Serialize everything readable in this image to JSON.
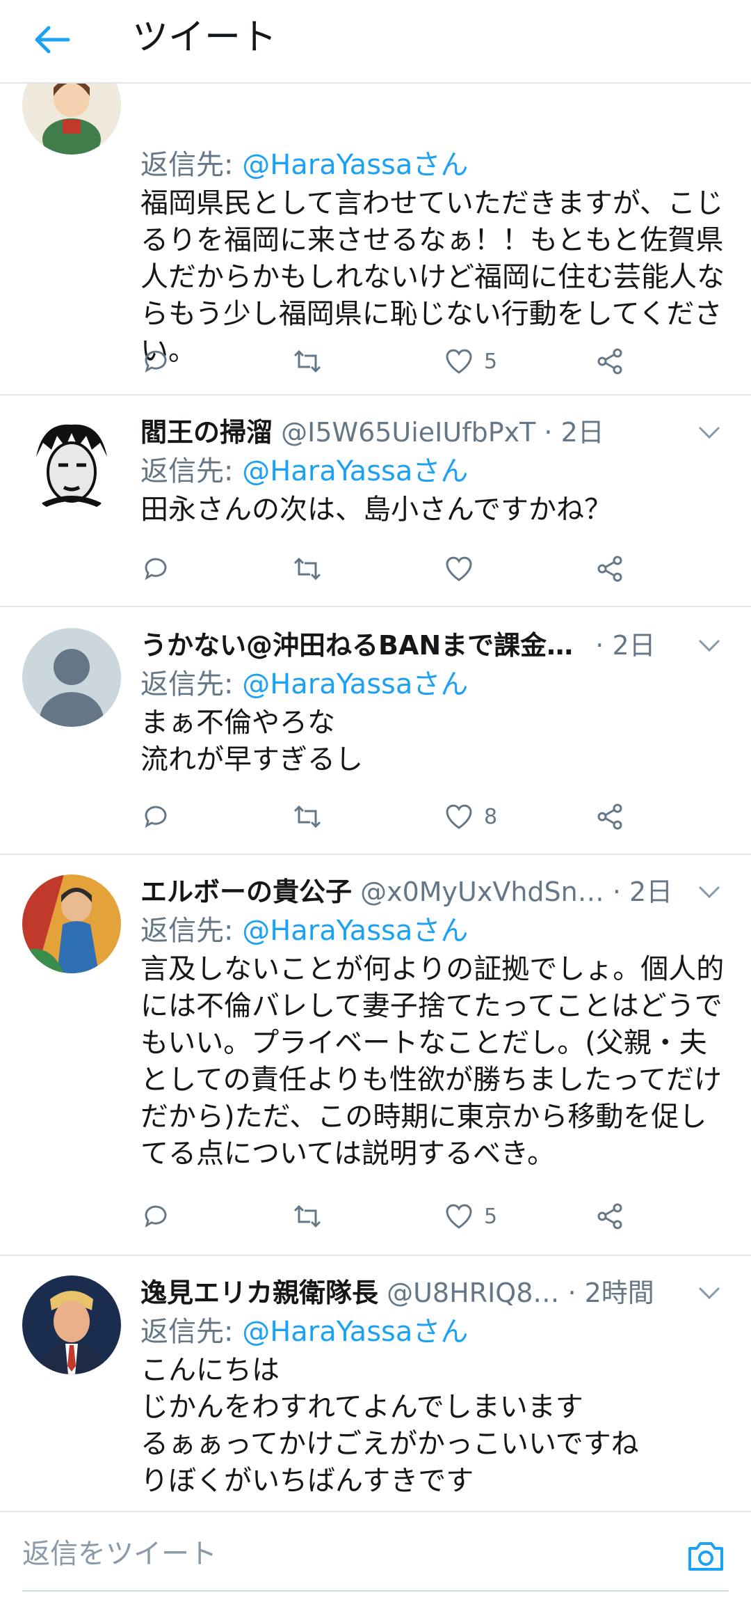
{
  "header": {
    "title": "ツイート"
  },
  "reply_prefix": "返信先: ",
  "tweets": [
    {
      "reply_to": "@HaraYassaさん",
      "body": "福岡県民として言わせていただきますが、こじるりを福岡に来させるなぁ！！もともと佐賀県人だからかもしれないけど福岡に住む芸能人ならもう少し福岡県に恥じない行動をしてください。",
      "likes": "5"
    },
    {
      "name": "閻王の掃溜",
      "handle": "@I5W65UieIUfbPxT",
      "time": "· 2日",
      "reply_to": "@HaraYassaさん",
      "body": "田永さんの次は、島小さんですかね？",
      "likes": ""
    },
    {
      "name": "うかない@沖田ねるBANまで課金…",
      "handle": "",
      "time": "· 2日",
      "reply_to": "@HaraYassaさん",
      "body": "まぁ不倫やろな\n流れが早すぎるし",
      "likes": "8"
    },
    {
      "name": "エルボーの貴公子",
      "handle": "@x0MyUxVhdSn…",
      "time": "· 2日",
      "reply_to": "@HaraYassaさん",
      "body": "言及しないことが何よりの証拠でしょ。個人的には不倫バレして妻子捨てたってことはどうでもいい。プライベートなことだし。(父親・夫としての責任よりも性欲が勝ちましたってだけだから)ただ、この時期に東京から移動を促してる点については説明するべき。",
      "likes": "5"
    },
    {
      "name": "逸見エリカ親衛隊長",
      "handle": "@U8HRIQ8…",
      "time": "· 2時間",
      "reply_to": "@HaraYassaさん",
      "body": "こんにちは\nじかんをわすれてよんでしまいます\nるぁぁってかけごえがかっこいいですね\nりぼくがいちばんすきです"
    }
  ],
  "compose": {
    "placeholder": "返信をツイート"
  },
  "colors": {
    "accent": "#1da1f2",
    "secondary": "#657786",
    "divider": "#e1e8ed"
  }
}
